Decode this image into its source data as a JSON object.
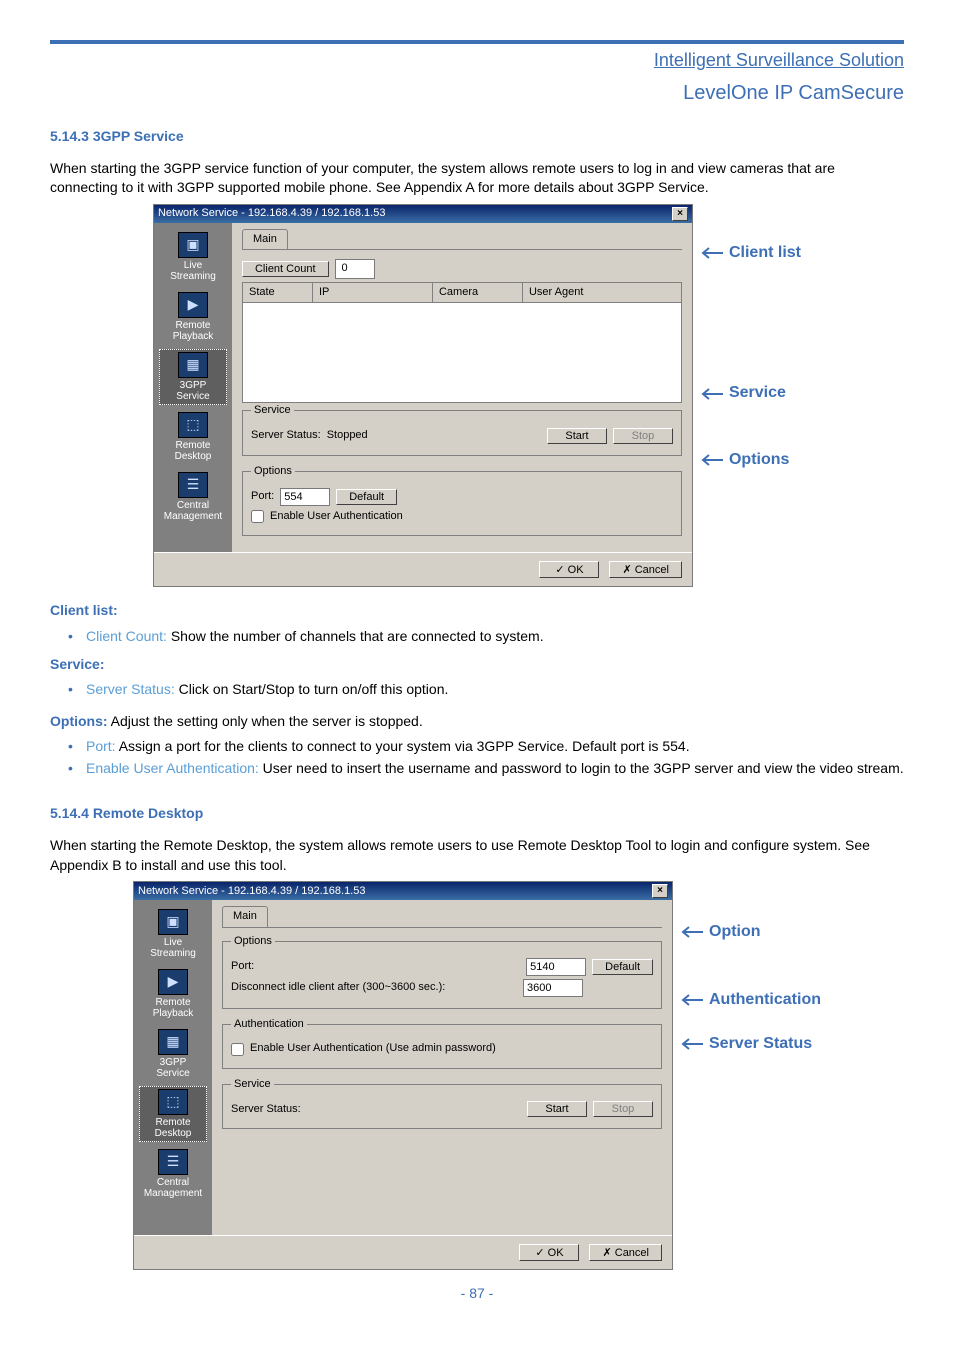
{
  "header": {
    "line1": "Intelligent Surveillance Solution",
    "line2": "LevelOne IP CamSecure"
  },
  "section1": {
    "heading": "5.14.3 3GPP Service",
    "intro": "When starting the 3GPP service function of your computer, the system allows remote users to log in and view cameras that are connecting to it with 3GPP supported mobile phone. See Appendix A for more details about 3GPP Service."
  },
  "win1": {
    "title": "Network Service - 192.168.4.39 / 192.168.1.53",
    "close": "×",
    "sidebar": {
      "items": [
        {
          "label": "Live Streaming",
          "glyph": "▣"
        },
        {
          "label": "Remote Playback",
          "glyph": "▶"
        },
        {
          "label": "3GPP Service",
          "glyph": "▦"
        },
        {
          "label": "Remote Desktop",
          "glyph": "⬚"
        },
        {
          "label": "Central Management",
          "glyph": "☰"
        }
      ],
      "selected_index": 2
    },
    "tab": "Main",
    "client_count_label": "Client Count",
    "client_count_value": "0",
    "columns": {
      "state": "State",
      "ip": "IP",
      "camera": "Camera",
      "ua": "User Agent"
    },
    "service": {
      "legend": "Service",
      "status_label": "Server Status:",
      "status_value": "Stopped",
      "start": "Start",
      "stop": "Stop"
    },
    "options": {
      "legend": "Options",
      "port_label": "Port:",
      "port_value": "554",
      "default": "Default",
      "auth_label": "Enable User Authentication"
    },
    "ok": "OK",
    "cancel": "Cancel"
  },
  "annot1": {
    "client_list": "Client list",
    "service": "Service",
    "options": "Options"
  },
  "defs1": {
    "client_list_label": "Client list:",
    "client_count_term": "Client Count:",
    "client_count_desc": " Show the number of channels that are connected to system.",
    "service_label": "Service:",
    "server_status_term": "Server Status:",
    "server_status_desc": " Click on Start/Stop to turn on/off this option.",
    "options_label": "Options:",
    "options_desc": " Adjust the setting only when the server is stopped.",
    "port_term": "Port:",
    "port_desc": " Assign a port for the clients to connect to your system via 3GPP Service. Default port is 554.",
    "eua_term": "Enable User Authentication:",
    "eua_desc": " User need to insert the username and password to login to the 3GPP server and view the video stream."
  },
  "section2": {
    "heading": "5.14.4 Remote Desktop",
    "intro": "When starting the Remote Desktop, the system allows remote users to use Remote Desktop Tool to login and configure system. See Appendix B to install and use this tool."
  },
  "win2": {
    "title": "Network Service - 192.168.4.39 / 192.168.1.53",
    "close": "×",
    "sidebar": {
      "items": [
        {
          "label": "Live Streaming",
          "glyph": "▣"
        },
        {
          "label": "Remote Playback",
          "glyph": "▶"
        },
        {
          "label": "3GPP Service",
          "glyph": "▦"
        },
        {
          "label": "Remote Desktop",
          "glyph": "⬚"
        },
        {
          "label": "Central Management",
          "glyph": "☰"
        }
      ],
      "selected_index": 3
    },
    "tab": "Main",
    "options": {
      "legend": "Options",
      "port_label": "Port:",
      "port_value": "5140",
      "default": "Default",
      "idle_label": "Disconnect idle client after (300~3600 sec.):",
      "idle_value": "3600"
    },
    "auth": {
      "legend": "Authentication",
      "label": "Enable User Authentication (Use admin password)"
    },
    "service": {
      "legend": "Service",
      "status_label": "Server Status:",
      "start": "Start",
      "stop": "Stop"
    },
    "ok": "OK",
    "cancel": "Cancel"
  },
  "annot2": {
    "option": "Option",
    "auth": "Authentication",
    "server_status": "Server Status"
  },
  "page_number": "- 87 -"
}
